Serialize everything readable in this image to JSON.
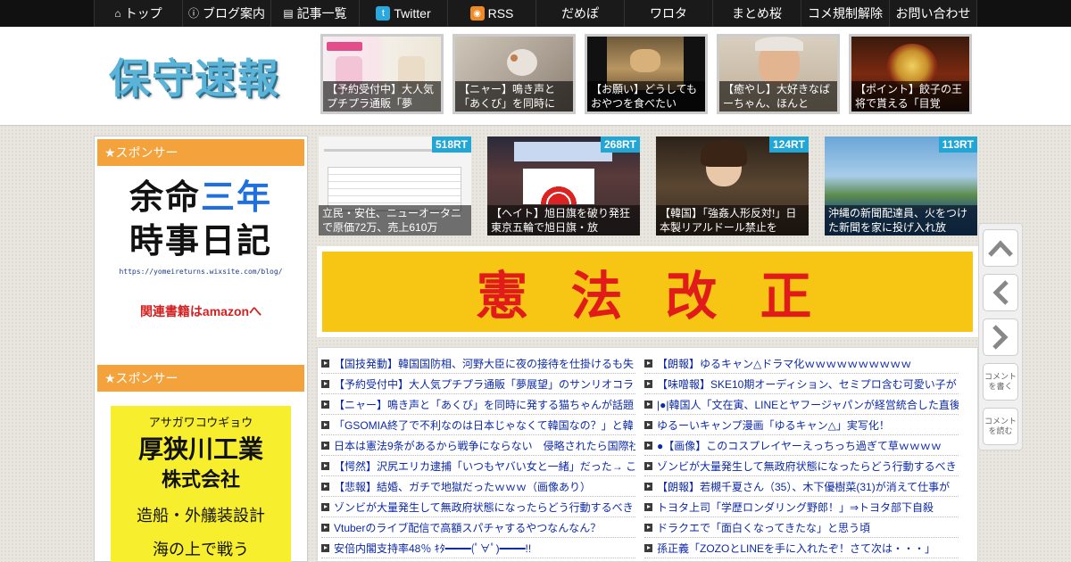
{
  "nav": {
    "items": [
      {
        "label": "トップ",
        "icon": "home-icon"
      },
      {
        "label": "ブログ案内",
        "icon": "info-icon"
      },
      {
        "label": "記事一覧",
        "icon": "list-icon"
      },
      {
        "label": "Twitter",
        "icon": "twitter-icon"
      },
      {
        "label": "RSS",
        "icon": "rss-icon"
      },
      {
        "label": "だめぽ"
      },
      {
        "label": "ワロタ"
      },
      {
        "label": "まとめ桜"
      },
      {
        "label": "コメ規制解除"
      },
      {
        "label": "お問い合わせ"
      }
    ]
  },
  "header": {
    "logo": "保守速報",
    "thumbs": [
      {
        "caption": "【予約受付中】大人気プチプラ通販「夢"
      },
      {
        "caption": "【ニャー】鳴き声と「あくび」を同時に"
      },
      {
        "caption": "【お願い】どうしてもおやつを食べたい"
      },
      {
        "caption": "【癒やし】大好きなばーちゃん、ほんと"
      },
      {
        "caption": "【ポイント】餃子の王将で貰える「目覚"
      }
    ]
  },
  "sidebar": {
    "sponsor_title_1": "★スポンサー",
    "sponsor_title_2": "★スポンサー",
    "ad1": {
      "line1_a": "余命",
      "line1_b": "三年",
      "line2": "時事日記",
      "url": "https://yomeireturns.wixsite.com/blog/",
      "amazon": "関連書籍はamazonへ"
    },
    "ad2": {
      "kana": "アサガワコウギョウ",
      "company": "厚狭川工業",
      "kk": "株式会社",
      "biz": "造船・外艤装設計",
      "more": "海の上で戦う"
    }
  },
  "rt_cards": [
    {
      "badge": "518RT",
      "caption": "立民・安住、ニューオータニで原価72万、売上610万"
    },
    {
      "badge": "268RT",
      "caption": "【ヘイト】旭日旗を破り発狂 東京五輪で旭日旗・放"
    },
    {
      "badge": "124RT",
      "caption": "【韓国】「強姦人形反対!」日本製リアルドール禁止を"
    },
    {
      "badge": "113RT",
      "caption": "沖縄の新聞配達員、火をつけた新聞を家に投げ入れ放"
    }
  ],
  "banner": {
    "text": "憲法改正"
  },
  "links_left": [
    "【国技発動】韓国国防相、河野大臣に夜の接待を仕掛けるも失",
    "【予約受付中】大人気プチプラ通販「夢展望」のサンリオコラ",
    "【ニャー】鳴き声と「あくび」を同時に発する猫ちゃんが話題",
    "「GSOMIA終了で不利なのは日本じゃなくて韓国なの？」と韓",
    "日本は憲法9条があるから戦争にならない　侵略されたら国際社",
    "【愕然】沢尻エリカ逮捕「いつもヤバい女と一緒」だった→ こ",
    "【悲報】結婚、ガチで地獄だったｗｗｗ（画像あり）",
    "ゾンビが大量発生して無政府状態になったらどう行動するべき",
    "Vtuberのライブ配信で高額スパチャするやつなんなん？",
    "安倍内閣支持率48％ ｷﾀ━━━━(ﾟ∀ﾟ)━━━━!!"
  ],
  "links_right": [
    "【朗報】ゆるキャン△ドラマ化ｗｗｗｗｗｗｗｗｗｗ",
    "【味噌報】SKE10期オーディション、セミプロ含む可愛い子が",
    "|●|韓国人「文在寅、LINEとヤフージャパンが経営統合した直後",
    "ゆるーいキャンプ漫画「ゆるキャン△」実写化！",
    "●【画像】このコスプレイヤーえっちっち過ぎて草ｗｗｗｗ",
    "ゾンビが大量発生して無政府状態になったらどう行動するべき",
    "【朗報】若槻千夏さん（35）、木下優樹菜(31)が消えて仕事が",
    "トヨタ上司「学歴ロンダリング野郎！」⇒トヨタ部下自殺",
    "ドラクエで「面白くなってきたな」と思う頃",
    "孫正義「ZOZOとLINEを手に入れたぞ！さて次は・・・」"
  ],
  "float": {
    "write_comment": "コメントを書く",
    "read_comment": "コメントを読む"
  }
}
